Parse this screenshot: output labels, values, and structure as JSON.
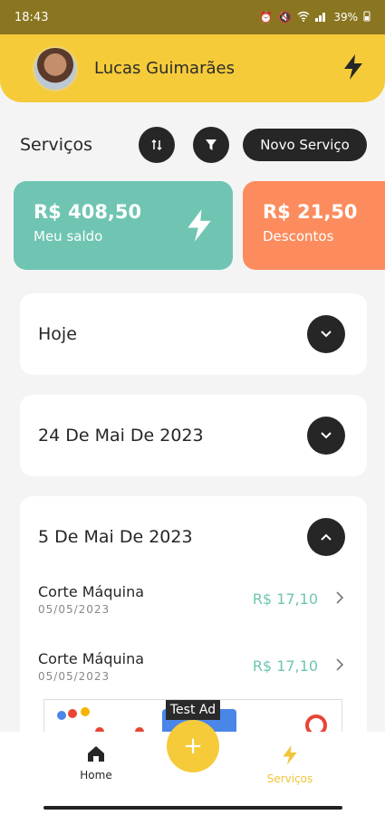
{
  "status_bar": {
    "time": "18:43",
    "battery": "39%"
  },
  "header": {
    "user_name": "Lucas Guimarães"
  },
  "services": {
    "title": "Serviços",
    "new_button": "Novo Serviço"
  },
  "cards": {
    "balance": {
      "amount": "R$ 408,50",
      "label": "Meu saldo"
    },
    "discount": {
      "amount": "R$ 21,50",
      "label": "Descontos"
    }
  },
  "groups": [
    {
      "title": "Hoje",
      "expanded": false
    },
    {
      "title": "24 De Mai De 2023",
      "expanded": false
    },
    {
      "title": "5 De Mai De 2023",
      "expanded": true,
      "items": [
        {
          "name": "Corte Máquina",
          "date": "05/05/2023",
          "price": "R$ 17,10"
        },
        {
          "name": "Corte Máquina",
          "date": "05/05/2023",
          "price": "R$ 17,10"
        }
      ]
    }
  ],
  "ad": {
    "label": "Test Ad"
  },
  "nav": {
    "home": "Home",
    "services": "Serviços",
    "fab": "+"
  },
  "colors": {
    "accent_yellow": "#f6cb3a",
    "teal": "#6fc5b2",
    "orange": "#fc8c5d",
    "dark": "#262626"
  }
}
